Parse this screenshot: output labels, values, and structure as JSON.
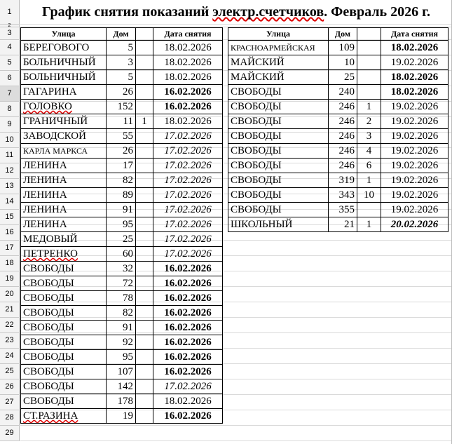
{
  "title": "График снятия показаний электр.счетчиков. Февраль 2026 г.",
  "title_parts": {
    "plain": "График снятия показаний ",
    "marked": "электр.счетчиков",
    "rest": ". Февраль 2026 г."
  },
  "row_numbers": [
    "1",
    "2",
    "3",
    "4",
    "5",
    "6",
    "7",
    "8",
    "9",
    "10",
    "11",
    "12",
    "13",
    "14",
    "15",
    "16",
    "17",
    "18",
    "19",
    "20",
    "21",
    "22",
    "23",
    "24",
    "25",
    "26",
    "27",
    "28",
    "29"
  ],
  "selected_row": "7",
  "left_table": {
    "headers": {
      "street": "Улица",
      "house": "Дом",
      "extra": "",
      "date": "Дата снятия"
    },
    "rows": [
      {
        "street": "БЕРЕГОВОГО",
        "house": "5",
        "extra": "",
        "date": "18.02.2026",
        "style": "n",
        "street_mark": false,
        "small": false
      },
      {
        "street": "БОЛЬНИЧНЫЙ",
        "house": "3",
        "extra": "",
        "date": "18.02.2026",
        "style": "n",
        "street_mark": false,
        "small": false
      },
      {
        "street": "БОЛЬНИЧНЫЙ",
        "house": "5",
        "extra": "",
        "date": "18.02.2026",
        "style": "n",
        "street_mark": false,
        "small": false
      },
      {
        "street": "ГАГАРИНА",
        "house": "26",
        "extra": "",
        "date": "16.02.2026",
        "style": "b",
        "street_mark": false,
        "small": false
      },
      {
        "street": "ГОЛОВКО",
        "house": "152",
        "extra": "",
        "date": "16.02.2026",
        "style": "b",
        "street_mark": true,
        "small": false
      },
      {
        "street": "ГРАНИЧНЫЙ",
        "house": "11",
        "extra": "1",
        "date": "18.02.2026",
        "style": "n",
        "street_mark": false,
        "small": false
      },
      {
        "street": "ЗАВОДСКОЙ",
        "house": "55",
        "extra": "",
        "date": "17.02.2026",
        "style": "i",
        "street_mark": false,
        "small": false
      },
      {
        "street": "КАРЛА МАРКСА",
        "house": "26",
        "extra": "",
        "date": "17.02.2026",
        "style": "i",
        "street_mark": false,
        "small": true
      },
      {
        "street": "ЛЕНИНА",
        "house": "17",
        "extra": "",
        "date": "17.02.2026",
        "style": "i",
        "street_mark": false,
        "small": false
      },
      {
        "street": "ЛЕНИНА",
        "house": "82",
        "extra": "",
        "date": "17.02.2026",
        "style": "i",
        "street_mark": false,
        "small": false
      },
      {
        "street": "ЛЕНИНА",
        "house": "89",
        "extra": "",
        "date": "17.02.2026",
        "style": "i",
        "street_mark": false,
        "small": false
      },
      {
        "street": "ЛЕНИНА",
        "house": "91",
        "extra": "",
        "date": "17.02.2026",
        "style": "i",
        "street_mark": false,
        "small": false
      },
      {
        "street": "ЛЕНИНА",
        "house": "95",
        "extra": "",
        "date": "17.02.2026",
        "style": "i",
        "street_mark": false,
        "small": false
      },
      {
        "street": "МЕДОВЫЙ",
        "house": "25",
        "extra": "",
        "date": "17.02.2026",
        "style": "i",
        "street_mark": false,
        "small": false
      },
      {
        "street": "ПЕТРЕНКО",
        "house": "60",
        "extra": "",
        "date": "17.02.2026",
        "style": "i",
        "street_mark": true,
        "small": false
      },
      {
        "street": "СВОБОДЫ",
        "house": "32",
        "extra": "",
        "date": "16.02.2026",
        "style": "b",
        "street_mark": false,
        "small": false
      },
      {
        "street": "СВОБОДЫ",
        "house": "72",
        "extra": "",
        "date": "16.02.2026",
        "style": "b",
        "street_mark": false,
        "small": false
      },
      {
        "street": "СВОБОДЫ",
        "house": "78",
        "extra": "",
        "date": "16.02.2026",
        "style": "b",
        "street_mark": false,
        "small": false
      },
      {
        "street": "СВОБОДЫ",
        "house": "82",
        "extra": "",
        "date": "16.02.2026",
        "style": "b",
        "street_mark": false,
        "small": false
      },
      {
        "street": "СВОБОДЫ",
        "house": "91",
        "extra": "",
        "date": "16.02.2026",
        "style": "b",
        "street_mark": false,
        "small": false
      },
      {
        "street": "СВОБОДЫ",
        "house": "92",
        "extra": "",
        "date": "16.02.2026",
        "style": "b",
        "street_mark": false,
        "small": false
      },
      {
        "street": "СВОБОДЫ",
        "house": "95",
        "extra": "",
        "date": "16.02.2026",
        "style": "b",
        "street_mark": false,
        "small": false
      },
      {
        "street": "СВОБОДЫ",
        "house": "107",
        "extra": "",
        "date": "16.02.2026",
        "style": "b",
        "street_mark": false,
        "small": false
      },
      {
        "street": "СВОБОДЫ",
        "house": "142",
        "extra": "",
        "date": "17.02.2026",
        "style": "i",
        "street_mark": false,
        "small": false
      },
      {
        "street": "СВОБОДЫ",
        "house": "178",
        "extra": "",
        "date": "18.02.2026",
        "style": "n",
        "street_mark": false,
        "small": false
      },
      {
        "street": "СТ.РАЗИНА",
        "house": "19",
        "extra": "",
        "date": "16.02.2026",
        "style": "b",
        "street_mark": true,
        "small": false
      }
    ]
  },
  "right_table": {
    "headers": {
      "street": "Улица",
      "house": "Дом",
      "extra": "",
      "date": "Дата снятия"
    },
    "rows": [
      {
        "street": "КРАСНОАРМЕЙСКАЯ",
        "house": "109",
        "extra": "",
        "date": "18.02.2026",
        "style": "b",
        "street_mark": false,
        "small": true
      },
      {
        "street": "МАЙСКИЙ",
        "house": "10",
        "extra": "",
        "date": "19.02.2026",
        "style": "n",
        "street_mark": false,
        "small": false
      },
      {
        "street": "МАЙСКИЙ",
        "house": "25",
        "extra": "",
        "date": "18.02.2026",
        "style": "b",
        "street_mark": false,
        "small": false
      },
      {
        "street": "СВОБОДЫ",
        "house": "240",
        "extra": "",
        "date": "18.02.2026",
        "style": "b",
        "street_mark": false,
        "small": false
      },
      {
        "street": "СВОБОДЫ",
        "house": "246",
        "extra": "1",
        "date": "19.02.2026",
        "style": "n",
        "street_mark": false,
        "small": false
      },
      {
        "street": "СВОБОДЫ",
        "house": "246",
        "extra": "2",
        "date": "19.02.2026",
        "style": "n",
        "street_mark": false,
        "small": false
      },
      {
        "street": "СВОБОДЫ",
        "house": "246",
        "extra": "3",
        "date": "19.02.2026",
        "style": "n",
        "street_mark": false,
        "small": false
      },
      {
        "street": "СВОБОДЫ",
        "house": "246",
        "extra": "4",
        "date": "19.02.2026",
        "style": "n",
        "street_mark": false,
        "small": false
      },
      {
        "street": "СВОБОДЫ",
        "house": "246",
        "extra": "6",
        "date": "19.02.2026",
        "style": "n",
        "street_mark": false,
        "small": false
      },
      {
        "street": "СВОБОДЫ",
        "house": "319",
        "extra": "1",
        "date": "19.02.2026",
        "style": "n",
        "street_mark": false,
        "small": false
      },
      {
        "street": "СВОБОДЫ",
        "house": "343",
        "extra": "10",
        "date": "19.02.2026",
        "style": "n",
        "street_mark": false,
        "small": false
      },
      {
        "street": "СВОБОДЫ",
        "house": "355",
        "extra": "",
        "date": "19.02.2026",
        "style": "n",
        "street_mark": false,
        "small": false
      },
      {
        "street": "ШКОЛЬНЫЙ",
        "house": "21",
        "extra": "1",
        "date": "20.02.2026",
        "style": "bi",
        "street_mark": false,
        "small": false
      }
    ]
  }
}
